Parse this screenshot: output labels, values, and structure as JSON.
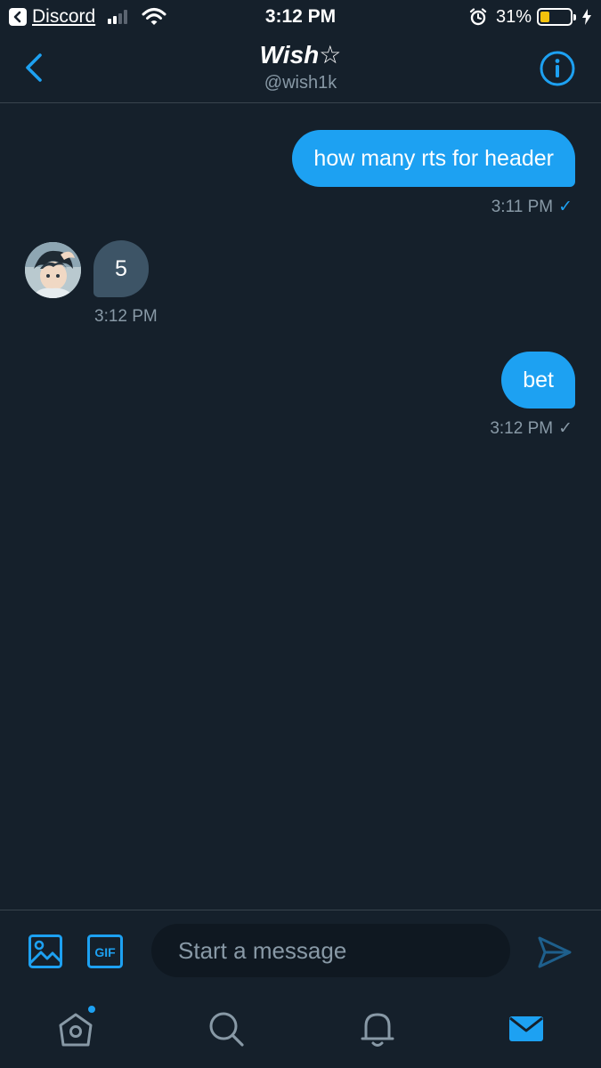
{
  "status_bar": {
    "back_app": "Discord",
    "time": "3:12 PM",
    "battery_percent": "31%",
    "battery_level": 0.31,
    "battery_color": "#f4c20d",
    "icons": [
      "signal-icon",
      "wifi-icon",
      "alarm-icon",
      "battery-icon",
      "charging-icon"
    ]
  },
  "header": {
    "title": "Wish☆",
    "handle": "@wish1k",
    "back_icon": "chevron-left-icon",
    "info_icon": "info-icon",
    "accent_color": "#1da1f2"
  },
  "messages": [
    {
      "direction": "outgoing",
      "text": "how many rts for header",
      "time": "3:11 PM",
      "status": "✓",
      "status_color": "#1da1f2"
    },
    {
      "direction": "incoming",
      "text": "5",
      "time": "3:12 PM"
    },
    {
      "direction": "outgoing",
      "text": "bet",
      "time": "3:12 PM",
      "status": "✓",
      "status_color": "#8899a6"
    }
  ],
  "composer": {
    "placeholder": "Start a message",
    "gif_label": "GIF",
    "icons": [
      "image-icon",
      "gif-icon",
      "send-icon"
    ]
  },
  "tabbar": {
    "items": [
      "home-icon",
      "search-icon",
      "notifications-icon",
      "messages-icon"
    ],
    "active": "messages-icon",
    "home_has_badge": true
  },
  "colors": {
    "background": "#15202b",
    "outgoing_bubble": "#1da1f2",
    "incoming_bubble": "#3d5466",
    "secondary_text": "#8899a6",
    "divider": "#38444d"
  }
}
